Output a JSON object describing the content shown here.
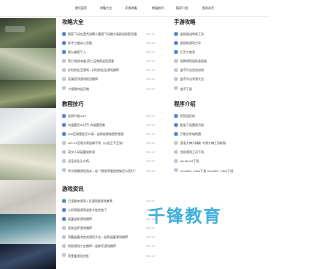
{
  "topnav": {
    "items": [
      "绝玩首页",
      "攻略大全",
      "手游攻略",
      "教程技巧",
      "程序介绍",
      "游戏资讯"
    ]
  },
  "watermark": "千锋教育",
  "colors": {
    "bullet_active": "#5a7fd8",
    "bullet_muted": "#bcc6de",
    "watermark": "#1fa2d8"
  },
  "sections": {
    "guides": {
      "title": "攻略大全",
      "items": [
        {
          "text": "暗区飞马台西式说明小图层飞马推力追踪最新配合策",
          "date": "06-12"
        },
        {
          "text": "新手七堂杀心法策",
          "date": "06-12"
        },
        {
          "text": "模从曲装于入",
          "date": "06-12"
        },
        {
          "text": "死亡地狱冰晶-死亡岛收取最佳装备",
          "date": "06-12"
        },
        {
          "text": "好玩的生空游戏－好玩的生生游戏推荐",
          "date": "06-12"
        },
        {
          "text": "完美复刻游戏和目推荐",
          "date": "06-12"
        },
        {
          "text": "大量国内最高端",
          "date": "06-12"
        }
      ]
    },
    "mobile": {
      "title": "手游攻略",
      "items": [
        {
          "text": "金钱版战场前工具",
          "date": "06-12"
        },
        {
          "text": "金钱版游戏分享",
          "date": "06-12"
        },
        {
          "text": "计天大地道",
          "date": "06-12"
        },
        {
          "text": "最稀游戏最新金钱版",
          "date": "06-12"
        },
        {
          "text": "金币平台合合动攻",
          "date": "06-12"
        },
        {
          "text": "金币平台手游大全",
          "date": "06-12"
        },
        {
          "text": "金币下载",
          "date": "06-12"
        }
      ]
    },
    "tutorials": {
      "title": "教程技巧",
      "items": [
        {
          "text": "如何升级ios7",
          "date": "06-12"
        },
        {
          "text": "内涵图怎么打开 内涵图查看",
          "date": "06-12"
        },
        {
          "text": "ww应用便捷怎么用－最新版微信更新便捷",
          "date": "06-12"
        },
        {
          "text": "win11应用交易最看不到（从此正不正常）",
          "date": "06-12"
        },
        {
          "text": "英文人间画面最新选",
          "date": "06-12"
        },
        {
          "text": "道宝资生头大辉",
          "date": "06-12"
        },
        {
          "text": "华为荣耀游戏选关－在一屏含带便捷微信怎么查打？",
          "date": "06-12"
        }
      ]
    },
    "programs": {
      "title": "程序介绍",
      "items": [
        {
          "text": "智慧宫影视",
          "date": "06-12"
        },
        {
          "text": "极速下载器官方版",
          "date": "06-12"
        },
        {
          "text": "万能文件编辑器",
          "date": "06-12"
        },
        {
          "text": "滚滚大神大辅助 卡游大神工具新版",
          "date": "06-12"
        },
        {
          "text": "迅捷游戏工具下载",
          "date": "06-12"
        },
        {
          "text": "ap.ap.wt下载",
          "date": "06-12"
        },
        {
          "text": "musetic cube下载 musetic cube下载",
          "date": "06-12"
        }
      ]
    },
    "news": {
      "title": "游戏资讯",
      "items": [
        {
          "text": "日漫剧本游戏+日漫网游游戏推荐",
          "date": "06-12"
        },
        {
          "text": "火影网络游戏最新大集合免下",
          "date": "06-12"
        },
        {
          "text": "画面最新游戏推荐",
          "date": "06-12"
        },
        {
          "text": "武侠爱怀游戏推荐",
          "date": "06-12"
        },
        {
          "text": "有趣画面冲击感游戏大全－最新画面游戏推荐",
          "date": "06-12"
        },
        {
          "text": "特别游戏大全推荐－最新乐游戏推荐",
          "date": "06-12"
        },
        {
          "text": "家里面游戏合集",
          "date": "06-12"
        }
      ]
    }
  }
}
